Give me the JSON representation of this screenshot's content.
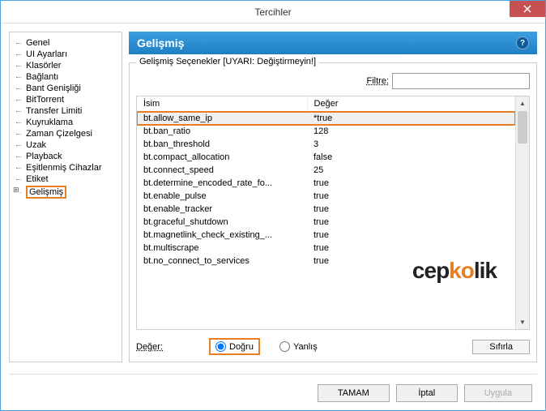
{
  "window": {
    "title": "Tercihler"
  },
  "tree": {
    "items": [
      {
        "label": "Genel"
      },
      {
        "label": "UI Ayarları"
      },
      {
        "label": "Klasörler"
      },
      {
        "label": "Bağlantı"
      },
      {
        "label": "Bant Genişliği"
      },
      {
        "label": "BitTorrent"
      },
      {
        "label": "Transfer Limiti"
      },
      {
        "label": "Kuyruklama"
      },
      {
        "label": "Zaman Çizelgesi"
      },
      {
        "label": "Uzak"
      },
      {
        "label": "Playback"
      },
      {
        "label": "Eşitlenmiş Cihazlar"
      },
      {
        "label": "Etiket"
      },
      {
        "label": "Gelişmiş"
      }
    ]
  },
  "panel": {
    "title": "Gelişmiş",
    "fieldset_legend": "Gelişmiş Seçenekler [UYARI: Değiştirmeyin!]",
    "filter_label": "Filtre:",
    "filter_value": ""
  },
  "table": {
    "col_name": "İsim",
    "col_value": "Değer",
    "rows": [
      {
        "name": "bt.allow_same_ip",
        "value": "*true",
        "selected": true,
        "highlight": true
      },
      {
        "name": "bt.ban_ratio",
        "value": "128"
      },
      {
        "name": "bt.ban_threshold",
        "value": "3"
      },
      {
        "name": "bt.compact_allocation",
        "value": "false"
      },
      {
        "name": "bt.connect_speed",
        "value": "25"
      },
      {
        "name": "bt.determine_encoded_rate_fo...",
        "value": "true"
      },
      {
        "name": "bt.enable_pulse",
        "value": "true"
      },
      {
        "name": "bt.enable_tracker",
        "value": "true"
      },
      {
        "name": "bt.graceful_shutdown",
        "value": "true"
      },
      {
        "name": "bt.magnetlink_check_existing_...",
        "value": "true"
      },
      {
        "name": "bt.multiscrape",
        "value": "true"
      },
      {
        "name": "bt.no_connect_to_services",
        "value": "true"
      }
    ]
  },
  "value_editor": {
    "label": "Değer:",
    "radio_true": "Doğru",
    "radio_false": "Yanlış",
    "reset": "Sıfırla"
  },
  "buttons": {
    "ok": "TAMAM",
    "cancel": "İptal",
    "apply": "Uygula"
  },
  "watermark": {
    "part1": "cep",
    "part2": "ko",
    "part3": "lik"
  },
  "colors": {
    "accent": "#e67e22",
    "header": "#2b8dce"
  }
}
